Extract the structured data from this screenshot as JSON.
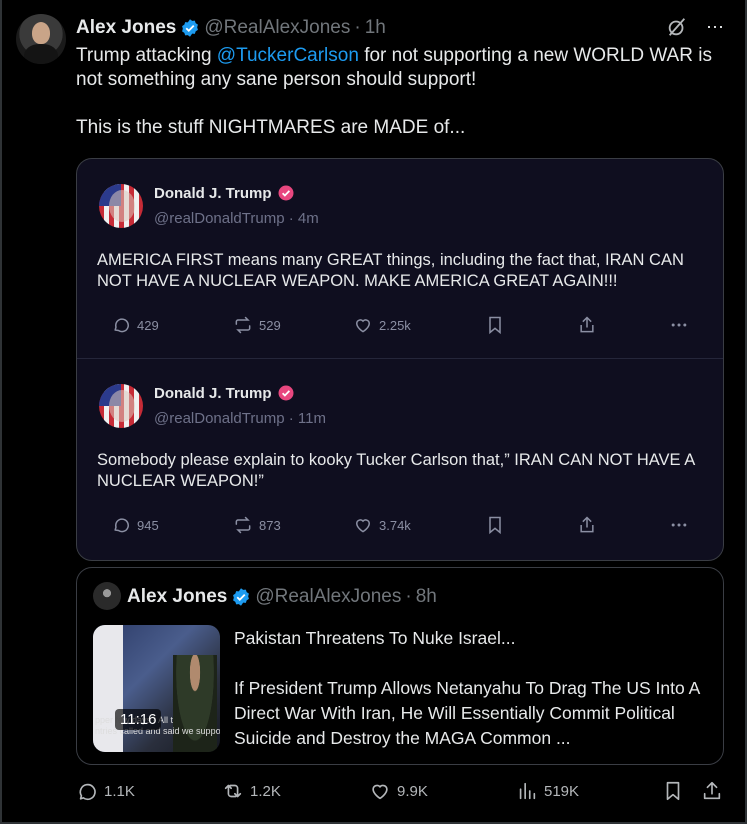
{
  "tweet": {
    "author_name": "Alex Jones",
    "author_handle": "@RealAlexJones",
    "separator": "·",
    "time": "1h",
    "text_before_mention": "Trump attacking ",
    "mention": "@TuckerCarlson",
    "text_after_mention": " for not supporting a new WORLD WAR is not something any sane person should support!",
    "text_second_paragraph": "This is the stuff NIGHTMARES are MADE of...",
    "more_icon": "⋯"
  },
  "embedded_posts": [
    {
      "author_name": "Donald J. Trump",
      "author_handle": "@realDonaldTrump",
      "time": "4m",
      "text": "AMERICA FIRST means many GREAT things, including the fact that, IRAN CAN NOT HAVE A NUCLEAR WEAPON. MAKE AMERICA GREAT AGAIN!!!",
      "replies": "429",
      "retruths": "529",
      "likes": "2.25k"
    },
    {
      "author_name": "Donald J. Trump",
      "author_handle": "@realDonaldTrump",
      "time": "11m",
      "text": "Somebody please explain to kooky Tucker Carlson that,” IRAN CAN NOT HAVE A NUCLEAR WEAPON!”",
      "replies": "945",
      "retruths": "873",
      "likes": "3.74k"
    }
  ],
  "quote": {
    "author_name": "Alex Jones",
    "author_handle": "@RealAlexJones",
    "time": "8h",
    "video_duration": "11:16",
    "video_caption_line1": "pper    few days? All t",
    "video_caption_line2": "ntries called and said we support",
    "title": "Pakistan Threatens To Nuke Israel...",
    "body": "If President Trump Allows Netanyahu To Drag The US Into A Direct War With Iran, He Will Essentially Commit Political Suicide and Destroy the MAGA Common ..."
  },
  "actions": {
    "replies": "1.1K",
    "reposts": "1.2K",
    "likes": "9.9K",
    "views": "519K"
  },
  "colors": {
    "background": "#000000",
    "text": "#e7e9ea",
    "muted": "#71767b",
    "link": "#1d9bf0",
    "verified": "#1d9bf0",
    "embed_background": "#0f0e1f",
    "truth_check": "#e8477f"
  }
}
